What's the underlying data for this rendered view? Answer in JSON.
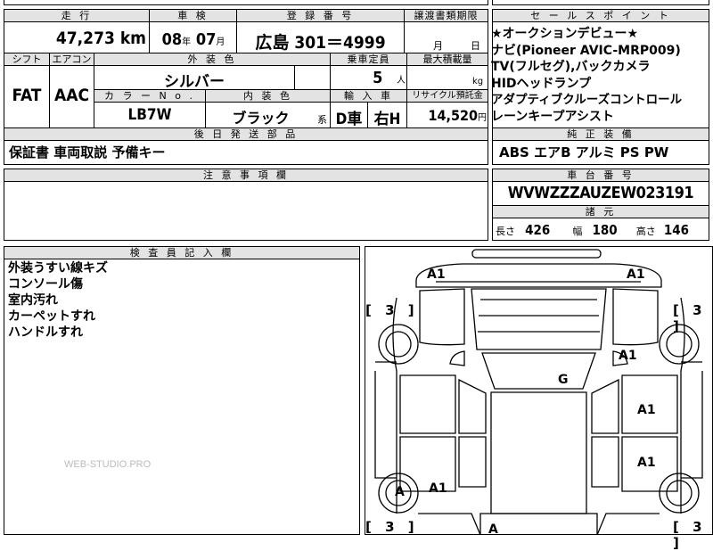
{
  "main_info": {
    "headers": {
      "mileage": "走 行",
      "inspection": "車 検",
      "registration": "登 録 番 号",
      "transfer": "譲渡書類期限"
    },
    "mileage": "47,273",
    "mileage_unit": "km",
    "inspection_year": "08",
    "inspection_year_unit": "年",
    "inspection_month": "07",
    "inspection_month_unit": "月",
    "registration": "広島 301＝4999",
    "transfer_month_label": "月",
    "transfer_day_label": "日"
  },
  "vehicle_details": {
    "headers": {
      "shift": "シフト",
      "aircon": "エアコン",
      "exterior_color": "外 装 色",
      "capacity": "乗車定員",
      "max_load": "最大積載量",
      "color_no": "カ ラ ー N o .",
      "interior_color": "内 装 色",
      "import": "輸 入 車",
      "recycle": "リサイクル預託金"
    },
    "shift": "FAT",
    "aircon": "AAC",
    "exterior_color": "シルバー",
    "capacity": "5",
    "capacity_unit": "人",
    "max_load_unit": "kg",
    "color_no": "LB7W",
    "interior_color": "ブラック",
    "interior_suffix": "系",
    "import_dealer": "D車",
    "steering": "右H",
    "recycle": "14,520",
    "recycle_unit": "円"
  },
  "sales_points": {
    "header": "セ ー ル ス ポ イ ン ト",
    "lines": [
      "★オークションデビュー★",
      "ナビ(Pioneer AVIC-MRP009)",
      "TV(フルセグ),バックカメラ",
      "HIDヘッドランプ",
      "アダプティブクルーズコントロール",
      "レーンキープアシスト"
    ]
  },
  "later_parts": {
    "header": "後 日 発 送 部 品",
    "items": "保証書 車両取説 予備キー"
  },
  "genuine_equipment": {
    "header": "純 正 装 備",
    "items": "ABS エアB アルミ PS PW"
  },
  "notes": {
    "header": "注 意 事 項 欄"
  },
  "chassis": {
    "header": "車 台 番 号",
    "number": "WVWZZZAUZEW023191"
  },
  "specs": {
    "header": "諸 元",
    "length_label": "長さ",
    "length": "426",
    "width_label": "幅",
    "width": "180",
    "height_label": "高さ",
    "height": "146"
  },
  "inspector": {
    "header": "検 査 員 記 入 欄",
    "notes": [
      "外装うすい線キズ",
      "コンソール傷",
      "室内汚れ",
      "カーペットすれ",
      "ハンドルすれ"
    ],
    "watermark": "WEB-STUDIO.PRO"
  },
  "diagram": {
    "marks": {
      "front_left_bumper": "A1",
      "front_right_bumper": "A1",
      "right_front_fender": "A1",
      "windshield": "G",
      "right_front_door": "A1",
      "right_rear_door": "A1",
      "left_rear_wheel": "A",
      "left_rear_quarter": "A1",
      "rear": "A"
    },
    "tire_labels": {
      "front_left": "[ 3 ]",
      "front_right": "[ 3 ]",
      "rear_left": "[ 3 ]",
      "rear_right": "[ 3 ]"
    }
  }
}
